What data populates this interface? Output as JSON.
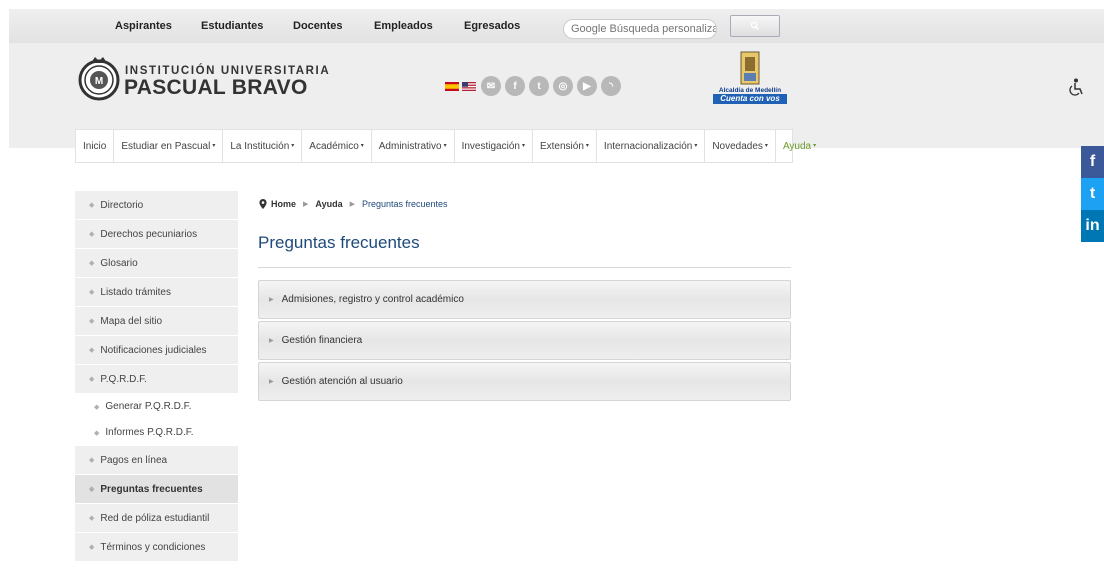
{
  "topbar": {
    "nav": [
      {
        "label": "Aspirantes"
      },
      {
        "label": "Estudiantes"
      },
      {
        "label": "Docentes"
      },
      {
        "label": "Empleados"
      },
      {
        "label": "Egresados"
      }
    ],
    "search_placeholder": "Google Búsqueda personalizad",
    "search_icon": "search-icon"
  },
  "header": {
    "logo_line1": "INSTITUCIÓN UNIVERSITARIA",
    "logo_line2": "PASCUAL BRAVO",
    "logo_seal_letter": "M",
    "social_icons": [
      "mail-icon",
      "facebook-icon",
      "twitter-icon",
      "instagram-icon",
      "youtube-icon",
      "rss-icon"
    ],
    "alcaldia_line1": "Alcaldía de Medellín",
    "alcaldia_line2": "Cuenta con vos"
  },
  "mainmenu": [
    {
      "label": "Inicio",
      "caret": ""
    },
    {
      "label": "Estudiar en Pascual",
      "caret": "▾"
    },
    {
      "label": "La Institución",
      "caret": "▾"
    },
    {
      "label": "Académico",
      "caret": "▾"
    },
    {
      "label": "Administrativo",
      "caret": "▾"
    },
    {
      "label": "Investigación",
      "caret": "▾"
    },
    {
      "label": "Extensión",
      "caret": "▾"
    },
    {
      "label": "Internacionalización",
      "caret": "▾"
    },
    {
      "label": "Novedades",
      "caret": "▾"
    },
    {
      "label": "Ayuda",
      "caret": "▾"
    }
  ],
  "side_social": [
    {
      "label": "f",
      "color": "#3b5998"
    },
    {
      "label": "t",
      "color": "#1da1f2"
    },
    {
      "label": "in",
      "color": "#0077b5"
    }
  ],
  "sidebar": [
    {
      "label": "Directorio"
    },
    {
      "label": "Derechos pecuniarios"
    },
    {
      "label": "Glosario"
    },
    {
      "label": "Listado trámites"
    },
    {
      "label": "Mapa del sitio"
    },
    {
      "label": "Notificaciones judiciales"
    },
    {
      "label": "P.Q.R.D.F."
    },
    {
      "label": "Generar P.Q.R.D.F."
    },
    {
      "label": "Informes P.Q.R.D.F."
    },
    {
      "label": "Pagos en línea"
    },
    {
      "label": "Preguntas frecuentes"
    },
    {
      "label": "Red de póliza estudiantil"
    },
    {
      "label": "Términos y condiciones"
    }
  ],
  "breadcrumb": {
    "home": "Home",
    "section": "Ayuda",
    "current": "Preguntas frecuentes"
  },
  "page_title": "Preguntas frecuentes",
  "accordion": [
    {
      "label": "Admisiones, registro y control académico"
    },
    {
      "label": "Gestión financiera"
    },
    {
      "label": "Gestión atención al usuario"
    }
  ],
  "colors": {
    "title_blue": "#1e4a7a",
    "active_menu_green": "#6b9a2c",
    "alcaldia_blue": "#1f61b5"
  }
}
